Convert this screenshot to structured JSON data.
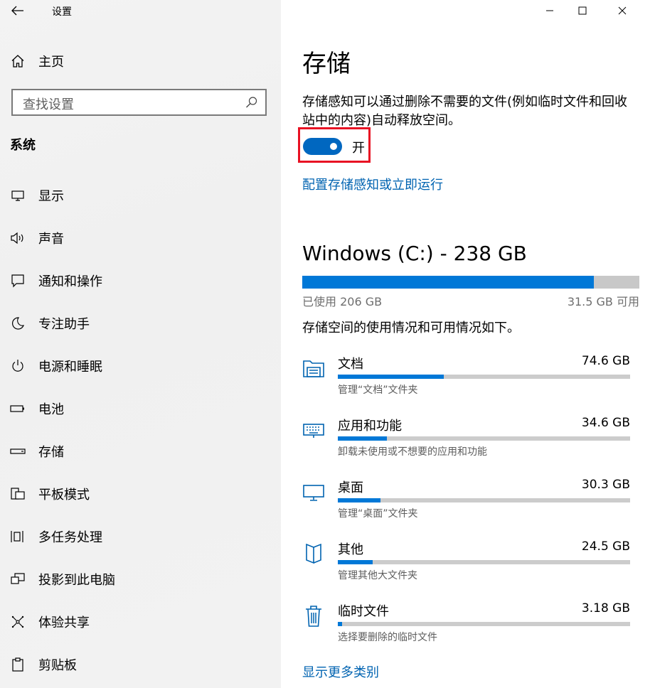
{
  "window": {
    "title": "设置"
  },
  "sidebar": {
    "home_label": "主页",
    "search_placeholder": "查找设置",
    "section": "系统",
    "items": [
      {
        "label": "显示",
        "icon": "monitor-icon"
      },
      {
        "label": "声音",
        "icon": "speaker-icon"
      },
      {
        "label": "通知和操作",
        "icon": "notification-icon"
      },
      {
        "label": "专注助手",
        "icon": "moon-icon"
      },
      {
        "label": "电源和睡眠",
        "icon": "power-icon"
      },
      {
        "label": "电池",
        "icon": "battery-icon"
      },
      {
        "label": "存储",
        "icon": "storage-icon"
      },
      {
        "label": "平板模式",
        "icon": "tablet-mode-icon"
      },
      {
        "label": "多任务处理",
        "icon": "multitasking-icon"
      },
      {
        "label": "投影到此电脑",
        "icon": "project-icon"
      },
      {
        "label": "体验共享",
        "icon": "share-icon"
      },
      {
        "label": "剪贴板",
        "icon": "clipboard-icon"
      }
    ]
  },
  "main": {
    "title": "存储",
    "description": "存储感知可以通过删除不需要的文件(例如临时文件和回收站中的内容)自动释放空间。",
    "toggle": {
      "state_label": "开",
      "on": true
    },
    "configure_link": "配置存储感知或立即运行",
    "drive": {
      "title": "Windows (C:) - 238 GB",
      "used_label": "已使用 206 GB",
      "free_label": "31.5 GB 可用",
      "used_fraction": 0.866
    },
    "usage_description": "存储空间的使用情况和可用情况如下。",
    "categories": [
      {
        "name": "文档",
        "size": "74.6 GB",
        "sub": "管理“文档”文件夹",
        "fraction": 0.362,
        "icon": "documents-folder-icon"
      },
      {
        "name": "应用和功能",
        "size": "34.6 GB",
        "sub": "卸载未使用或不想要的应用和功能",
        "fraction": 0.168,
        "icon": "apps-keyboard-icon"
      },
      {
        "name": "桌面",
        "size": "30.3 GB",
        "sub": "管理“桌面”文件夹",
        "fraction": 0.147,
        "icon": "desktop-monitor-icon"
      },
      {
        "name": "其他",
        "size": "24.5 GB",
        "sub": "管理其他大文件夹",
        "fraction": 0.119,
        "icon": "other-files-icon"
      },
      {
        "name": "临时文件",
        "size": "3.18 GB",
        "sub": "选择要删除的临时文件",
        "fraction": 0.015,
        "icon": "trash-icon"
      }
    ],
    "show_more_link": "显示更多类别"
  },
  "colors": {
    "accent": "#0078d7",
    "link": "#0063b1",
    "highlight": "#e81123"
  }
}
